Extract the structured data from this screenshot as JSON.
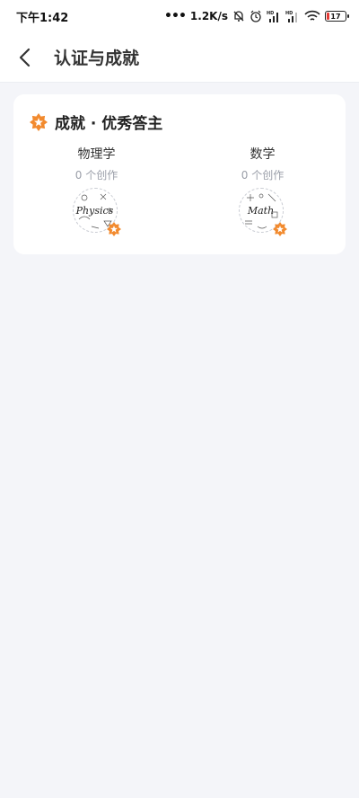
{
  "status_bar": {
    "time": "下午1:42",
    "network_speed": "1.2K/s",
    "battery_level": "17",
    "icons": [
      "more-dots-icon",
      "mute-bell-icon",
      "alarm-icon",
      "signal-icon",
      "signal-icon",
      "wifi-icon",
      "battery-icon"
    ]
  },
  "header": {
    "back_icon": "chevron-left-icon",
    "title": "认证与成就"
  },
  "achievement_card": {
    "icon": "orange-star-badge-icon",
    "title": "成就 · 优秀答主",
    "subjects": [
      {
        "name": "物理学",
        "count": "0 个创作",
        "badge_word": "Physics",
        "badge_icon": "physics-badge-icon"
      },
      {
        "name": "数学",
        "count": "0 个创作",
        "badge_word": "Math",
        "badge_icon": "math-badge-icon"
      }
    ]
  },
  "colors": {
    "page_background": "#f4f5f9",
    "card_background": "#ffffff",
    "badge_orange": "#f28a2e",
    "count_text": "#9a9ea8"
  }
}
